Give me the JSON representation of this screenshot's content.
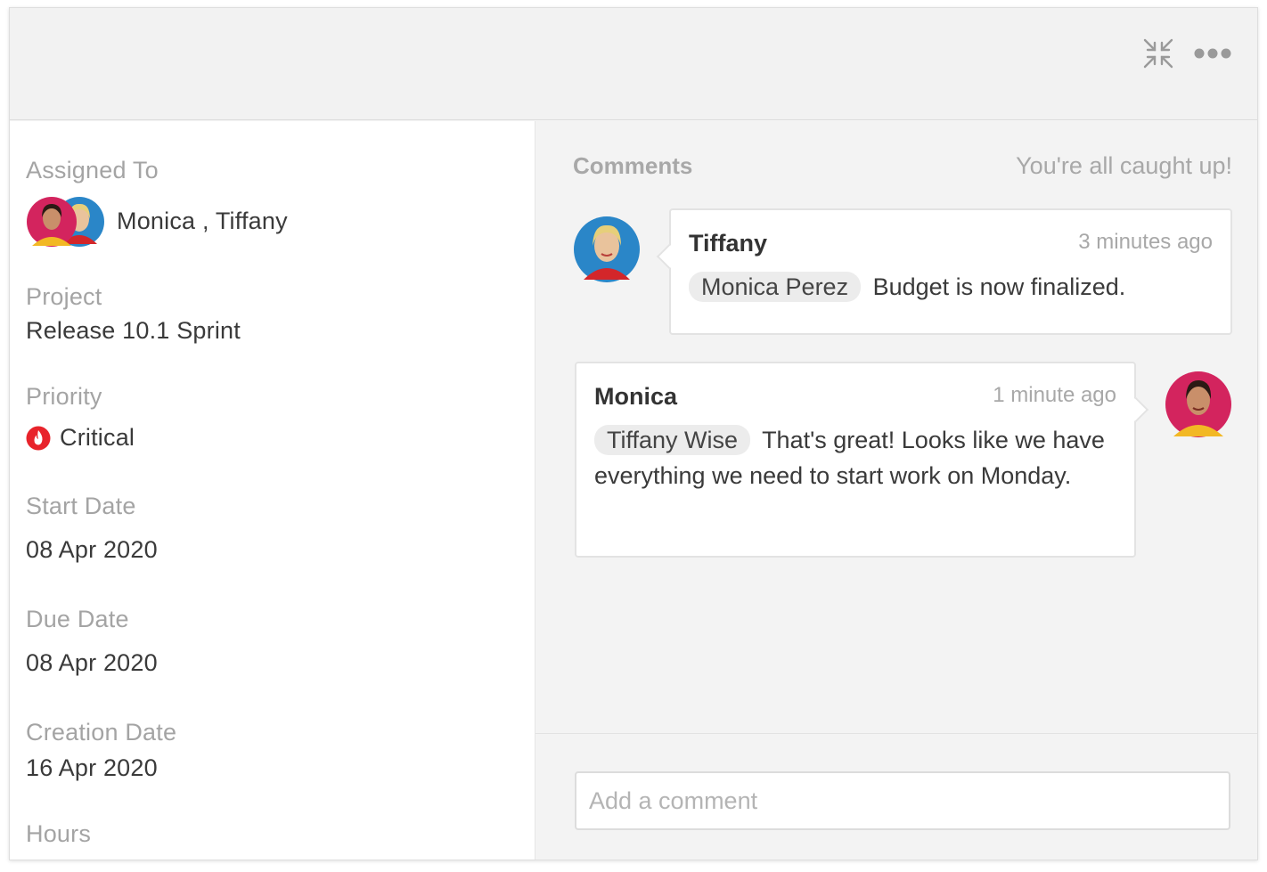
{
  "topbar": {
    "icons": [
      "collapse-arrows-icon",
      "more-options-icon"
    ]
  },
  "details": {
    "assigned_to": {
      "label": "Assigned To",
      "names": "Monica , Tiffany",
      "avatars": [
        "monica-avatar",
        "tiffany-avatar"
      ]
    },
    "project": {
      "label": "Project",
      "value": "Release 10.1 Sprint"
    },
    "priority": {
      "label": "Priority",
      "value": "Critical",
      "icon": "fire-icon",
      "color": "#e8232b"
    },
    "start_date": {
      "label": "Start Date",
      "value": "08 Apr 2020"
    },
    "due_date": {
      "label": "Due Date",
      "value": "08 Apr 2020"
    },
    "creation_date": {
      "label": "Creation Date",
      "value": "16 Apr 2020"
    },
    "hours": {
      "label": "Hours"
    }
  },
  "comments": {
    "title": "Comments",
    "status": "You're all caught up!",
    "items": [
      {
        "author": "Tiffany",
        "time": "3 minutes ago",
        "mention": "Monica  Perez",
        "text": "Budget is now finalized."
      },
      {
        "author": "Monica",
        "time": "1 minute ago",
        "mention": "Tiffany Wise",
        "text": "That's great! Looks like we have everything we need to start work on Monday."
      }
    ],
    "input_placeholder": "Add a comment"
  },
  "colors": {
    "monica_avatar_bg": "#d3245e",
    "monica_shirt": "#f2b824",
    "tiffany_avatar_bg": "#2a86c8",
    "tiffany_shirt": "#d3262a"
  }
}
